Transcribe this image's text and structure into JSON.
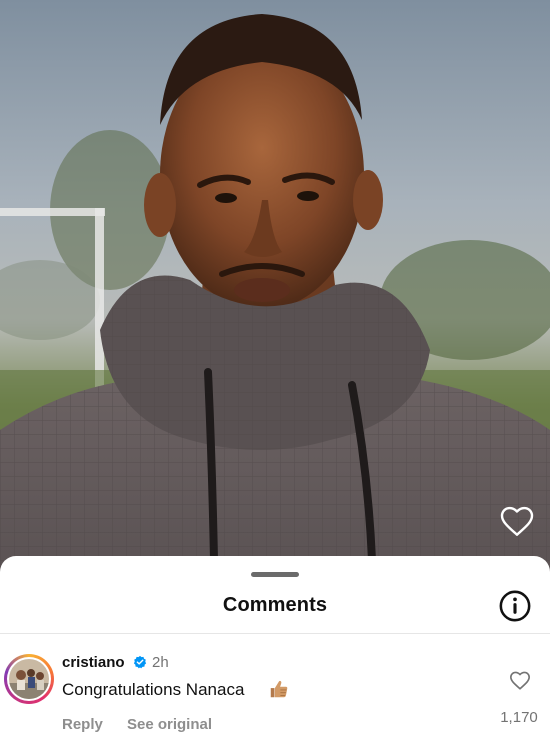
{
  "media": {
    "like_icon": "heart-outline-icon"
  },
  "sheet": {
    "title": "Comments",
    "info_icon": "info-icon"
  },
  "comment": {
    "username": "cristiano",
    "verified_icon": "verified-badge-icon",
    "time": "2h",
    "text": "Congratulations Nanaca",
    "emoji": "thumbs-up-emoji",
    "reply_label": "Reply",
    "see_original_label": "See original",
    "like_icon": "heart-outline-icon",
    "like_count": "1,170"
  },
  "colors": {
    "verified_blue": "#0095f6",
    "muted_text": "#737373",
    "primary_text": "#111111"
  }
}
